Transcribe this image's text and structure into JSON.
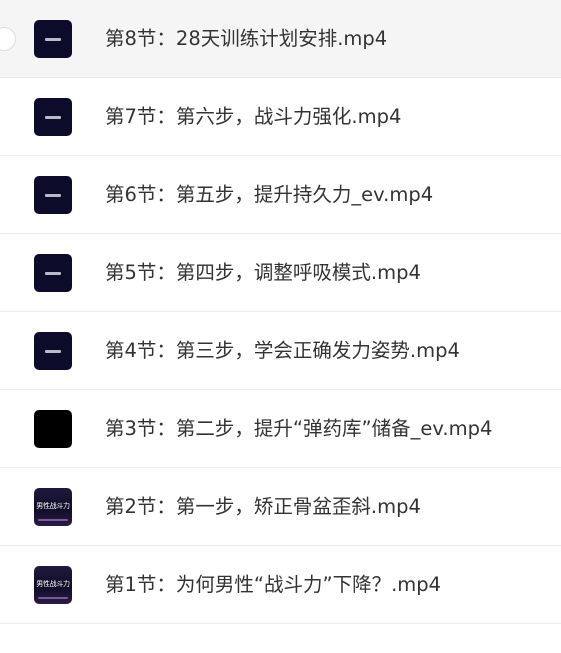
{
  "files": [
    {
      "name": "第8节：28天训练计划安排.mp4",
      "thumb": "navy",
      "selected": true
    },
    {
      "name": "第7节：第六步，战斗力强化.mp4",
      "thumb": "navy",
      "selected": false
    },
    {
      "name": "第6节：第五步，提升持久力_ev.mp4",
      "thumb": "navy",
      "selected": false
    },
    {
      "name": "第5节：第四步，调整呼吸模式.mp4",
      "thumb": "navy",
      "selected": false
    },
    {
      "name": "第4节：第三步，学会正确发力姿势.mp4",
      "thumb": "navy",
      "selected": false
    },
    {
      "name": "第3节：第二步，提升“弹药库”储备_ev.mp4",
      "thumb": "black",
      "selected": false
    },
    {
      "name": "第2节：第一步，矫正骨盆歪斜.mp4",
      "thumb": "titled",
      "thumb_text": "男性战斗力",
      "selected": false
    },
    {
      "name": "第1节：为何男性“战斗力”下降？.mp4",
      "thumb": "titled",
      "thumb_text": "男性战斗力",
      "selected": false
    }
  ]
}
